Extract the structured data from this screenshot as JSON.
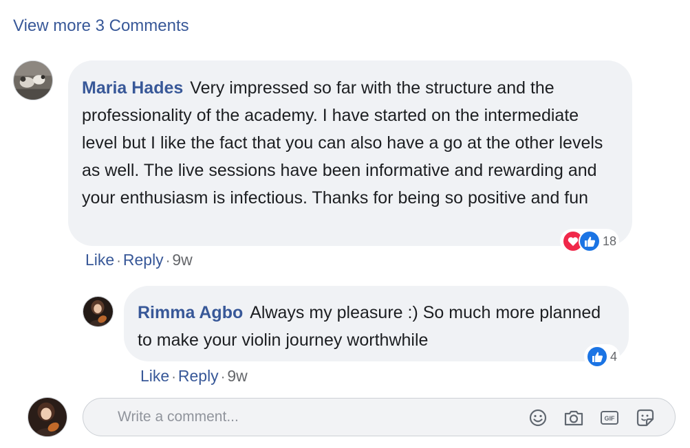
{
  "view_more_label": "View more 3 Comments",
  "comments": [
    {
      "author": "Maria Hades",
      "text": "Very impressed so far with the structure and the professionality of the academy. I have started on the intermediate level but I like the fact that you can also have a go at the other levels as well. The live sessions have been informative and rewarding and your enthusiasm is infectious. Thanks for being so positive and fun",
      "reactions": [
        "love-icon",
        "like-icon"
      ],
      "reaction_count": "18",
      "like_label": "Like",
      "reply_label": "Reply",
      "separator": "·",
      "timestamp": "9w"
    },
    {
      "author": "Rimma Agbo",
      "text": "Always my pleasure :) So much more planned to make your violin journey worthwhile",
      "reactions": [
        "like-icon"
      ],
      "reaction_count": "4",
      "like_label": "Like",
      "reply_label": "Reply",
      "separator": "·",
      "timestamp": "9w"
    }
  ],
  "composer": {
    "placeholder": "Write a comment...",
    "icons": [
      "emoji-icon",
      "camera-icon",
      "gif-icon",
      "sticker-icon"
    ],
    "gif_label": "GIF"
  },
  "colors": {
    "link": "#385898",
    "bubble": "#f0f2f5",
    "love": "#f0284a",
    "like": "#1b74e4",
    "muted": "#65676b"
  }
}
